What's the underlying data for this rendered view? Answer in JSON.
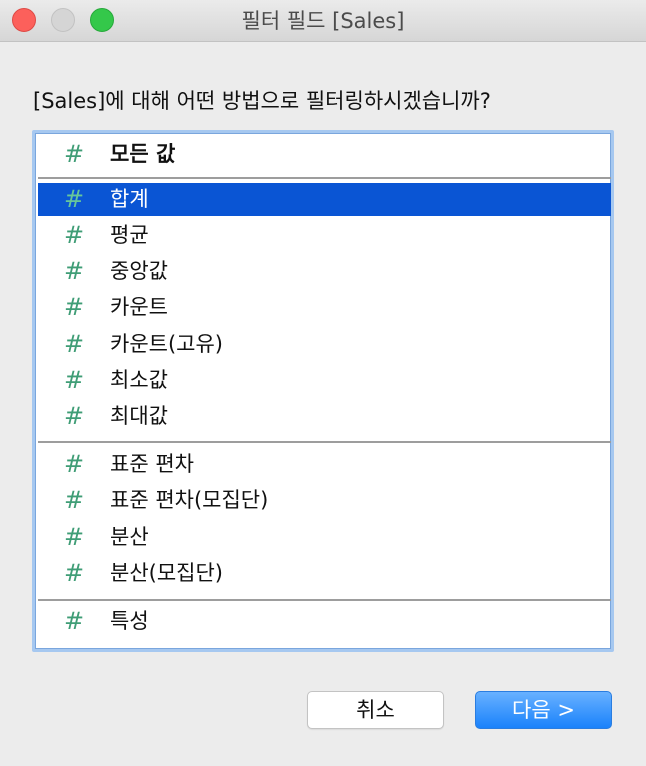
{
  "window": {
    "title": "필터 필드 [Sales]"
  },
  "prompt": "[Sales]에 대해 어떤 방법으로 필터링하시겠습니까?",
  "list": {
    "hash_glyph": "#",
    "selected_index": 1,
    "items": [
      {
        "label": "모든 값",
        "bold": true
      },
      {
        "label": "합계"
      },
      {
        "label": "평균"
      },
      {
        "label": "중앙값"
      },
      {
        "label": "카운트"
      },
      {
        "label": "카운트(고유)"
      },
      {
        "label": "최소값"
      },
      {
        "label": "최대값"
      },
      {
        "label": "표준 편차"
      },
      {
        "label": "표준 편차(모집단)"
      },
      {
        "label": "분산"
      },
      {
        "label": "분산(모집단)"
      },
      {
        "label": "특성"
      }
    ]
  },
  "buttons": {
    "cancel_label": "취소",
    "next_label": "다음 >"
  },
  "colors": {
    "selection": "#0a55d4",
    "hash_icon": "#3f9d76",
    "primary_button": "#1a82fb"
  }
}
